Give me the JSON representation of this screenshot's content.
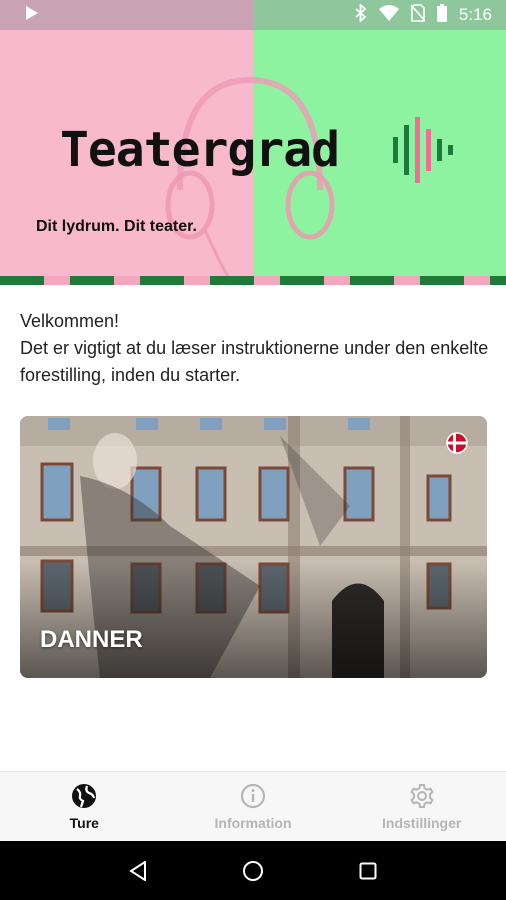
{
  "status_bar": {
    "time": "5:16",
    "icons": [
      "play-icon",
      "bluetooth-icon",
      "wifi-icon",
      "no-sim-icon",
      "battery-icon"
    ]
  },
  "hero": {
    "logo": "Teatergrad",
    "tagline": "Dit lydrum. Dit teater.",
    "colors": {
      "left": "#f8b9cd",
      "right": "#8ef3a0",
      "stripe_green": "#1f7a3a"
    }
  },
  "welcome": {
    "line1": "Velkommen!",
    "line2": "Det er vigtigt at du læser instruktionerne under den enkelte forestilling, inden du starter."
  },
  "tours": [
    {
      "title": "DANNER",
      "language_flag": "denmark-flag-icon"
    }
  ],
  "bottom_nav": {
    "items": [
      {
        "label": "Ture",
        "icon": "globe-icon",
        "active": true
      },
      {
        "label": "Information",
        "icon": "info-icon",
        "active": false
      },
      {
        "label": "Indstillinger",
        "icon": "gear-icon",
        "active": false
      }
    ]
  },
  "system_nav": [
    "back-icon",
    "home-icon",
    "recents-icon"
  ]
}
